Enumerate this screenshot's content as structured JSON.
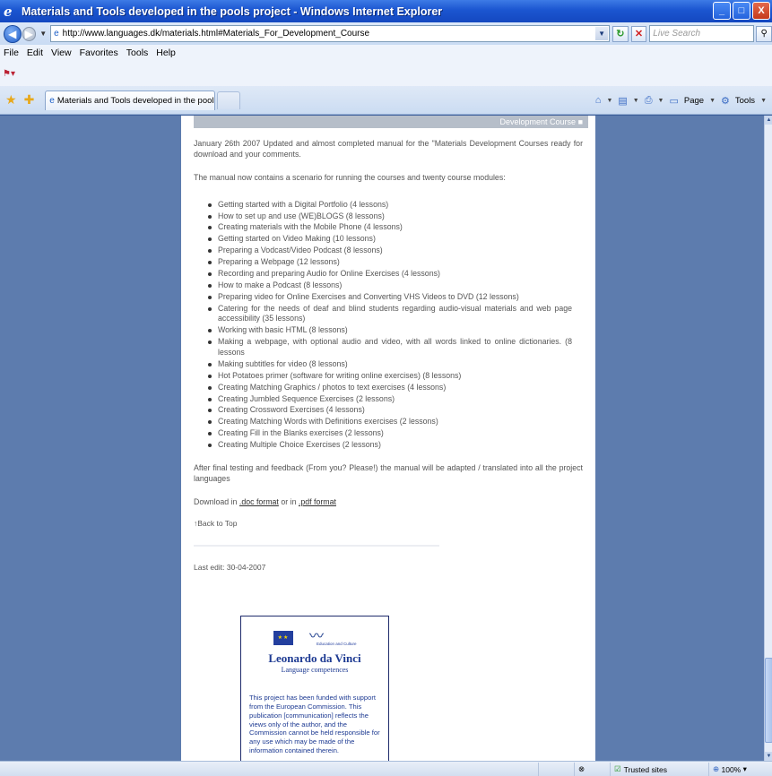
{
  "window": {
    "title": "Materials and Tools developed in the pools project - Windows Internet Explorer",
    "buttons": {
      "minimize": "_",
      "maximize": "□",
      "close": "X"
    }
  },
  "address_bar": {
    "url": "http://www.languages.dk/materials.html#Materials_For_Development_Course",
    "search_placeholder": "Live Search"
  },
  "menu": {
    "items": [
      "File",
      "Edit",
      "View",
      "Favorites",
      "Tools",
      "Help"
    ]
  },
  "tabs": [
    {
      "label": "Materials and Tools developed in the pools project"
    }
  ],
  "command_bar": {
    "page_label": "Page",
    "tools_label": "Tools"
  },
  "page": {
    "section_heading": "Development Course",
    "intro": "January 26th 2007 Updated and almost completed manual for the \"Materials Development Courses ready for download and your comments.",
    "modules_intro": "The manual now contains a scenario for running the courses and twenty course modules:",
    "modules": [
      "Getting started with a Digital Portfolio (4 lessons)",
      "How to set up and use (WE)BLOGS (8 lessons)",
      "Creating materials with the Mobile Phone (4 lessons)",
      "Getting started on Video Making (10 lessons)",
      "Preparing a Vodcast/Video Podcast (8 lessons)",
      "Preparing a Webpage (12 lessons)",
      "Recording and preparing Audio for Online Exercises (4 lessons)",
      "How to make a Podcast (8 lessons)",
      "Preparing video for Online Exercises and Converting VHS Videos to DVD (12 lessons)",
      "Catering for the needs of deaf and blind students regarding audio-visual materials and web page accessibility (35 lessons)",
      "Working with basic HTML (8 lessons)",
      "Making a webpage, with optional audio and video, with all words linked to online dictionaries. (8 lessons",
      "Making subtitles for video (8 lessons)",
      "Hot Potatoes primer (software for writing online exercises) (8 lessons)",
      "Creating Matching Graphics / photos to text exercises (4 lessons)",
      "Creating Jumbled Sequence Exercises (2 lessons)",
      "Creating Crossword Exercises (4 lessons)",
      "Creating Matching Words with Definitions exercises (2 lessons)",
      "Creating Fill in the Blanks exercises (2 lessons)",
      "Creating Multiple Choice Exercises (2 lessons)"
    ],
    "after_testing": "After final testing and feedback (From you? Please!) the manual will be adapted / translated into all the project languages",
    "download_prefix": "Download in",
    "doc_link": ".doc format",
    "download_or": "or in",
    "pdf_link": ".pdf format",
    "back_to_top": "Back to Top",
    "last_edit": "Last edit: 30-04-2007"
  },
  "leonardo_box": {
    "eac_label": "Education and Culture",
    "programme": "Leonardo da Vinci",
    "subtitle": "Language competences",
    "funded_text": "This project has been funded with support from the European Commission. This publication [communication] reflects the views only of the author, and the Commission cannot be held responsible for any use which may be made of the information contained therein."
  },
  "status_bar": {
    "zone": "Trusted sites",
    "zoom": "100%"
  },
  "colors": {
    "titlebar": "#1b55d0",
    "desktop": "#5d7cae",
    "page_bg": "#ffffff",
    "section_head": "#b6bec9"
  }
}
